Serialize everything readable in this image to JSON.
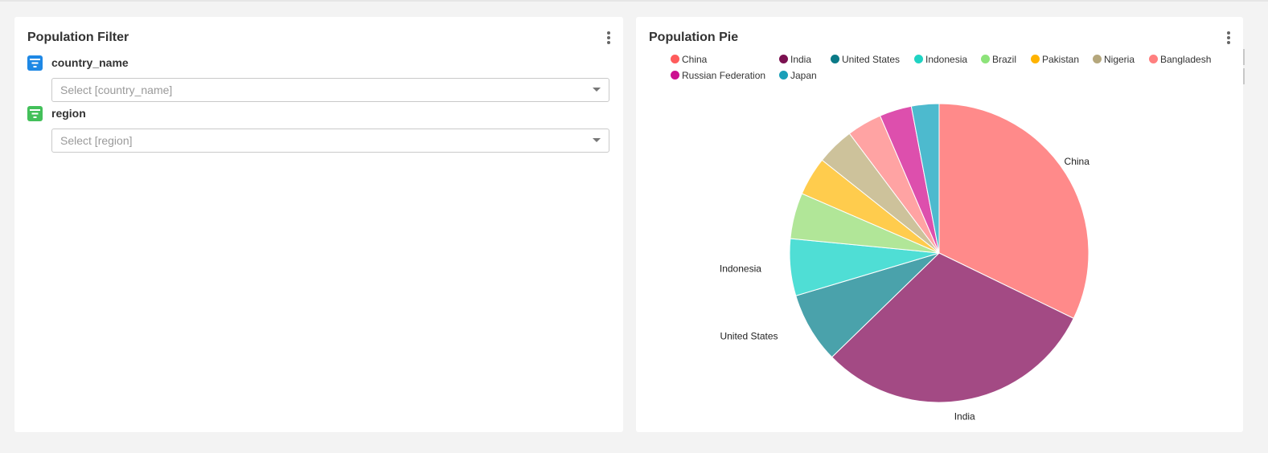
{
  "filter_panel": {
    "title": "Population Filter",
    "filters": [
      {
        "label": "country_name",
        "placeholder": "Select [country_name]",
        "icon": "filter-list-icon",
        "icon_color": "#1e88e5"
      },
      {
        "label": "region",
        "placeholder": "Select [region]",
        "icon": "filter-list-icon",
        "icon_color": "#43c05a"
      }
    ],
    "menu_icon": "vertical-dots-icon"
  },
  "pie_panel": {
    "title": "Population Pie",
    "menu_icon": "vertical-dots-icon",
    "legend": [
      {
        "label": "China",
        "color": "#ff5c5c"
      },
      {
        "label": "India",
        "color": "#7b1150"
      },
      {
        "label": "United States",
        "color": "#0b7a87"
      },
      {
        "label": "Indonesia",
        "color": "#1fd3c3"
      },
      {
        "label": "Brazil",
        "color": "#8de37a"
      },
      {
        "label": "Pakistan",
        "color": "#ffb300"
      },
      {
        "label": "Nigeria",
        "color": "#b5a77c"
      },
      {
        "label": "Bangladesh",
        "color": "#ff7f7f"
      },
      {
        "label": "Russian Federation",
        "color": "#cc1190"
      },
      {
        "label": "Japan",
        "color": "#1a9fb8"
      }
    ]
  },
  "chart_data": {
    "type": "pie",
    "categories": [
      "China",
      "India",
      "United States",
      "Indonesia",
      "Brazil",
      "Pakistan",
      "Nigeria",
      "Bangladesh",
      "Russian Federation",
      "Japan"
    ],
    "values": [
      32.4,
      30.7,
      7.7,
      6.2,
      5.0,
      4.2,
      4.1,
      3.8,
      3.5,
      3.0
    ],
    "slice_colors": [
      "#ff8a8a",
      "#a34a84",
      "#4aa2ab",
      "#4fded5",
      "#b1e698",
      "#ffcc4d",
      "#cdc29b",
      "#ffa3a3",
      "#dd4fad",
      "#4dbace"
    ],
    "slice_labels_shown": [
      "China",
      "India",
      "United States",
      "Indonesia"
    ],
    "start_angle": "12 o'clock",
    "direction": "clockwise",
    "legend_position": "top"
  }
}
